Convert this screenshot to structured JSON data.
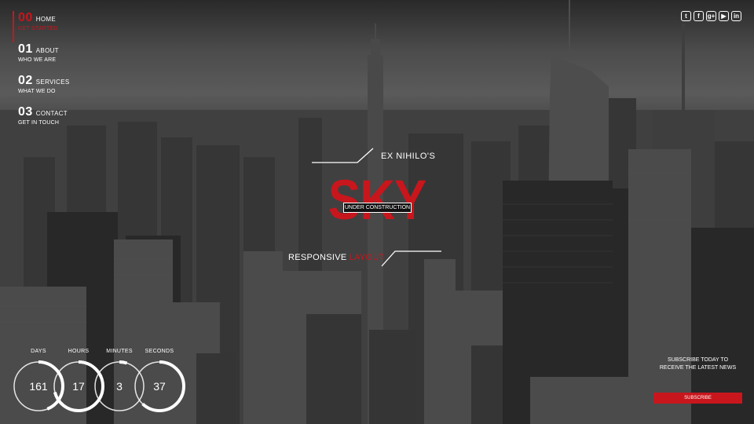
{
  "nav": [
    {
      "num": "00",
      "label": "HOME",
      "sub": "GET STARTED",
      "active": true
    },
    {
      "num": "01",
      "label": "ABOUT",
      "sub": "WHO WE ARE"
    },
    {
      "num": "02",
      "label": "SERVICES",
      "sub": "WHAT WE DO"
    },
    {
      "num": "03",
      "label": "CONTACT",
      "sub": "GET IN TOUCH"
    }
  ],
  "social": [
    {
      "icon": "twitter-icon",
      "glyph": "t"
    },
    {
      "icon": "facebook-icon",
      "glyph": "f"
    },
    {
      "icon": "google-plus-icon",
      "glyph": "g+"
    },
    {
      "icon": "youtube-icon",
      "glyph": "▶"
    },
    {
      "icon": "linkedin-icon",
      "glyph": "in"
    }
  ],
  "hero": {
    "brand": "EX NIHILO'S",
    "title": "SKY",
    "badge": "UNDER CONSTRUCTION",
    "tagline_white": "RESPONSIVE",
    "tagline_red": "LAYOUT"
  },
  "countdown": [
    {
      "label": "DAYS",
      "value": "161",
      "progress": 0.44
    },
    {
      "label": "HOURS",
      "value": "17",
      "progress": 0.71
    },
    {
      "label": "MINUTES",
      "value": "3",
      "progress": 0.05
    },
    {
      "label": "SECONDS",
      "value": "37",
      "progress": 0.62
    }
  ],
  "subscribe": {
    "line1": "SUBSCRIBE TODAY TO",
    "line2": "RECEIVE THE LATEST NEWS",
    "button": "SUBSCRIBE"
  },
  "colors": {
    "accent": "#c8161d",
    "text": "#ffffff"
  }
}
